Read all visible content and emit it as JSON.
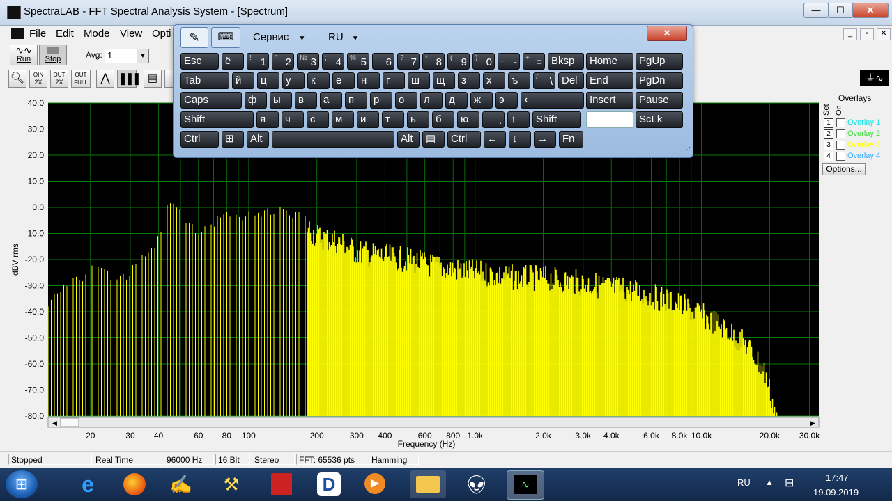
{
  "window": {
    "title": "SpectraLAB - FFT Spectral Analysis System - [Spectrum]",
    "minimize": "—",
    "maximize": "☐",
    "close": "✕"
  },
  "menu": [
    "File",
    "Edit",
    "Mode",
    "View",
    "Opti"
  ],
  "toolbar": {
    "run_label": "Run",
    "stop_label": "Stop",
    "avg_label": "Avg:",
    "avg_value": "1"
  },
  "zoom_buttons": [
    {
      "top": "",
      "bottom": ""
    },
    {
      "top": "OIN",
      "bottom": "2X"
    },
    {
      "top": "OUT",
      "bottom": "2X"
    },
    {
      "top": "OUT",
      "bottom": "FULL"
    }
  ],
  "chart_data": {
    "type": "bar",
    "xlabel": "Frequency (Hz)",
    "ylabel": "dBV rms",
    "ylim": [
      -80,
      40
    ],
    "x_scale": "log",
    "xlim": [
      13,
      33000
    ],
    "y_ticks": [
      "40.0",
      "30.0",
      "20.0",
      "10.0",
      "0.0",
      "-10.0",
      "-20.0",
      "-30.0",
      "-40.0",
      "-50.0",
      "-60.0",
      "-70.0",
      "-80.0"
    ],
    "x_ticks": [
      {
        "label": "20",
        "value": 20
      },
      {
        "label": "30",
        "value": 30
      },
      {
        "label": "40",
        "value": 40
      },
      {
        "label": "60",
        "value": 60
      },
      {
        "label": "80",
        "value": 80
      },
      {
        "label": "100",
        "value": 100
      },
      {
        "label": "200",
        "value": 200
      },
      {
        "label": "300",
        "value": 300
      },
      {
        "label": "400",
        "value": 400
      },
      {
        "label": "600",
        "value": 600
      },
      {
        "label": "800",
        "value": 800
      },
      {
        "label": "1.0k",
        "value": 1000
      },
      {
        "label": "2.0k",
        "value": 2000
      },
      {
        "label": "3.0k",
        "value": 3000
      },
      {
        "label": "4.0k",
        "value": 4000
      },
      {
        "label": "6.0k",
        "value": 6000
      },
      {
        "label": "8.0k",
        "value": 8000
      },
      {
        "label": "10.0k",
        "value": 10000
      },
      {
        "label": "20.0k",
        "value": 20000
      },
      {
        "label": "30.0k",
        "value": 30000
      }
    ],
    "grid": true,
    "series_color": "#ffff00",
    "envelope": [
      {
        "f": 13,
        "db": -36
      },
      {
        "f": 15,
        "db": -29
      },
      {
        "f": 18,
        "db": -25
      },
      {
        "f": 22,
        "db": -20
      },
      {
        "f": 26,
        "db": -26
      },
      {
        "f": 30,
        "db": -23
      },
      {
        "f": 35,
        "db": -17
      },
      {
        "f": 40,
        "db": -10
      },
      {
        "f": 45,
        "db": 5
      },
      {
        "f": 50,
        "db": 0
      },
      {
        "f": 55,
        "db": -6
      },
      {
        "f": 62,
        "db": -8
      },
      {
        "f": 70,
        "db": -4
      },
      {
        "f": 80,
        "db": 0
      },
      {
        "f": 95,
        "db": -2
      },
      {
        "f": 110,
        "db": 0
      },
      {
        "f": 130,
        "db": 1
      },
      {
        "f": 150,
        "db": 0
      },
      {
        "f": 180,
        "db": -2
      },
      {
        "f": 200,
        "db": -6
      },
      {
        "f": 250,
        "db": -8
      },
      {
        "f": 300,
        "db": -12
      },
      {
        "f": 400,
        "db": -14
      },
      {
        "f": 500,
        "db": -15
      },
      {
        "f": 700,
        "db": -18
      },
      {
        "f": 1000,
        "db": -20
      },
      {
        "f": 1500,
        "db": -22
      },
      {
        "f": 2000,
        "db": -22
      },
      {
        "f": 3000,
        "db": -24
      },
      {
        "f": 5000,
        "db": -27
      },
      {
        "f": 8000,
        "db": -32
      },
      {
        "f": 12000,
        "db": -40
      },
      {
        "f": 16000,
        "db": -48
      },
      {
        "f": 19000,
        "db": -58
      },
      {
        "f": 21000,
        "db": -72
      },
      {
        "f": 22000,
        "db": -80
      }
    ]
  },
  "overlays": {
    "title": "Overlays",
    "set_label": "Set",
    "on_label": "On",
    "items": [
      {
        "num": "1",
        "label": "Overlay 1",
        "color": "#00e5e5"
      },
      {
        "num": "2",
        "label": "Overlay 2",
        "color": "#33dd33"
      },
      {
        "num": "3",
        "label": "Overlay 3",
        "color": "#ffff00"
      },
      {
        "num": "4",
        "label": "Overlay 4",
        "color": "#33aaff"
      }
    ],
    "options_button": "Options..."
  },
  "status": [
    "Stopped",
    "Real Time",
    "96000 Hz",
    "16 Bit",
    "Stereo",
    "FFT: 65536 pts",
    "Hamming"
  ],
  "osk": {
    "service_label": "Сервис",
    "lang_label": "RU",
    "close": "✕",
    "rows": [
      [
        {
          "t": "Esc",
          "w": 55
        },
        {
          "t": "ё",
          "w": 32
        },
        {
          "t": "1",
          "top": "!",
          "w": 32
        },
        {
          "t": "2",
          "top": "\"",
          "w": 32
        },
        {
          "t": "3",
          "top": "№",
          "w": 32
        },
        {
          "t": "4",
          "top": ";",
          "w": 32
        },
        {
          "t": "5",
          "top": "%",
          "w": 32
        },
        {
          "t": "6",
          "top": ":",
          "w": 32
        },
        {
          "t": "7",
          "top": "?",
          "w": 32
        },
        {
          "t": "8",
          "top": "*",
          "w": 32
        },
        {
          "t": "9",
          "top": "(",
          "w": 32
        },
        {
          "t": "0",
          "top": ")",
          "w": 32
        },
        {
          "t": "-",
          "top": "_",
          "w": 32
        },
        {
          "t": "=",
          "top": "+",
          "w": 32
        },
        {
          "t": "Bksp",
          "w": 52
        }
      ],
      [
        {
          "t": "Tab",
          "w": 70
        },
        {
          "t": "й",
          "w": 32
        },
        {
          "t": "ц",
          "w": 32
        },
        {
          "t": "у",
          "w": 32
        },
        {
          "t": "к",
          "w": 32
        },
        {
          "t": "е",
          "w": 32
        },
        {
          "t": "н",
          "w": 32
        },
        {
          "t": "г",
          "w": 32
        },
        {
          "t": "ш",
          "w": 32
        },
        {
          "t": "щ",
          "w": 32
        },
        {
          "t": "з",
          "w": 32
        },
        {
          "t": "х",
          "w": 32
        },
        {
          "t": "ъ",
          "w": 32
        },
        {
          "t": "\\",
          "top": "/",
          "w": 32
        },
        {
          "t": "Del",
          "w": 37
        }
      ],
      [
        {
          "t": "Caps",
          "w": 88
        },
        {
          "t": "ф",
          "w": 32
        },
        {
          "t": "ы",
          "w": 32
        },
        {
          "t": "в",
          "w": 32
        },
        {
          "t": "а",
          "w": 32
        },
        {
          "t": "п",
          "w": 32
        },
        {
          "t": "р",
          "w": 32
        },
        {
          "t": "о",
          "w": 32
        },
        {
          "t": "л",
          "w": 32
        },
        {
          "t": "д",
          "w": 32
        },
        {
          "t": "ж",
          "w": 32
        },
        {
          "t": "э",
          "w": 32
        },
        {
          "t": "⟵",
          "w": 91
        }
      ],
      [
        {
          "t": "Shift",
          "w": 105
        },
        {
          "t": "я",
          "w": 32
        },
        {
          "t": "ч",
          "w": 32
        },
        {
          "t": "с",
          "w": 32
        },
        {
          "t": "м",
          "w": 32
        },
        {
          "t": "и",
          "w": 32
        },
        {
          "t": "т",
          "w": 32
        },
        {
          "t": "ь",
          "w": 32
        },
        {
          "t": "б",
          "w": 32
        },
        {
          "t": "ю",
          "w": 32
        },
        {
          "t": ".",
          "top": ",",
          "w": 32
        },
        {
          "t": "↑",
          "w": 32
        },
        {
          "t": "Shift",
          "w": 70
        }
      ],
      [
        {
          "t": "Ctrl",
          "w": 55
        },
        {
          "t": "⊞",
          "w": 32
        },
        {
          "t": "Alt",
          "w": 32
        },
        {
          "t": "",
          "w": 176
        },
        {
          "t": "Alt",
          "w": 32
        },
        {
          "t": "▤",
          "w": 32
        },
        {
          "t": "Ctrl",
          "w": 48
        },
        {
          "t": "←",
          "w": 32
        },
        {
          "t": "↓",
          "w": 32
        },
        {
          "t": "→",
          "w": 32
        },
        {
          "t": "Fn",
          "w": 35
        }
      ]
    ],
    "nav": [
      [
        "Home",
        "PgUp"
      ],
      [
        "End",
        "PgDn"
      ],
      [
        "Insert",
        "Pause"
      ],
      [
        "",
        "ScLk"
      ]
    ]
  },
  "taskbar": {
    "lang": "RU",
    "time": "17:47",
    "date": "19.09.2019"
  }
}
